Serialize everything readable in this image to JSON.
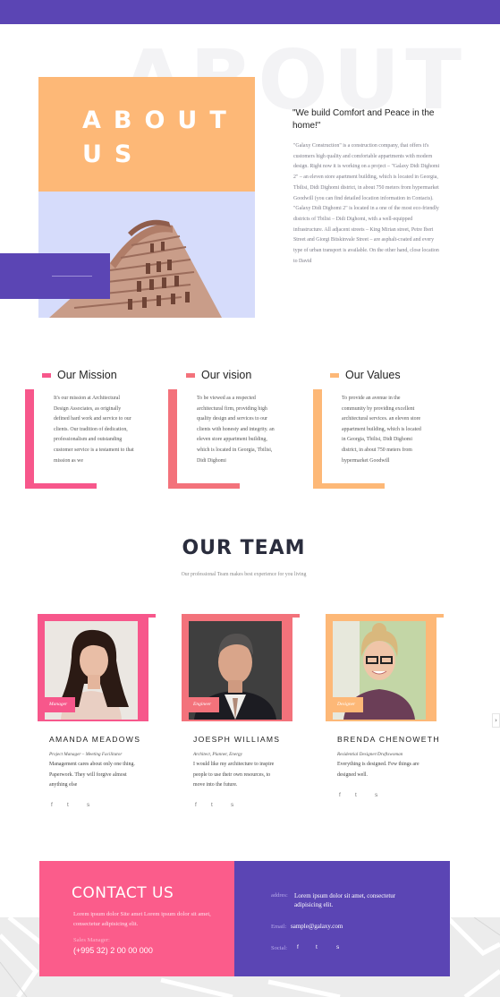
{
  "about": {
    "bg_word": "ABOUT",
    "title": "ABOUT US",
    "quote": "\"We build Comfort and Peace in the home!\"",
    "text": "\"Galaxy Construction\" is a construction company, that offers it's customers high quality and comfortable appartments with modern design. Right now it is working on a project – \"Galaxy Didi Dighomi 2\" – an eleven store apartment building, which is located in Georgia, Tbilisi, Didi Dighomi district, in about 750 meters from hypermarket Goodwill (you can find detailed location information in Contacts). \"Galaxy Didi Dighomi 2\" is located in a one of the most eco-friendly districts of Tbilisi – Didi Dighomi, with a well-equipped infrastructure. All adjacent streets – King Mirian street, Petre Iberi Street and Giorgi Bitskinvale Street – are asphalt-coated and every type of urban transport is available. On the other hand, close location to David"
  },
  "values": [
    {
      "title": "Our Mission",
      "color": "#f7578b",
      "text": "It's our mission at Architectural Design Associates, as originally defined hard work and service to our clients. Our tradition of dedication, professionalism and outstanding customer service is a testament to that mission as we"
    },
    {
      "title": "Our vision",
      "color": "#f3727b",
      "text": "To be viewed as a respected architectural firm, providing high quality design and services to our clients with honesty and integrity. an eleven store appartment building, which is located in Georgia, Tbilisi, Didi Dighomi"
    },
    {
      "title": "Our Values",
      "color": "#fdb877",
      "text": "To provide an avenue in the community by providing excellent architectural services. an eleven store appartment building, which is located in Georgia, Tbilisi, Didi Dighomi district, in about 750 meters from hypermarket Goodwill"
    }
  ],
  "team": {
    "title": "OUR TEAM",
    "subtitle": "Our professional Team makes best experience for you living",
    "members": [
      {
        "name": "AMANDA MEADOWS",
        "tag": "Manager",
        "role": "Project Manager – Meeting Facilitator",
        "desc": "Management cares about only one thing. Paperwork. They will forgive almost anything else",
        "color": "#f7578b"
      },
      {
        "name": "JOESPH WILLIAMS",
        "tag": "Engineer",
        "role": "Architect, Planner, Energy",
        "desc": "I would like my architecture to inspire people to use their own resources, to move into the future.",
        "color": "#f3727b"
      },
      {
        "name": "BRENDA CHENOWETH",
        "tag": "Designer",
        "role": "Residential Designer/Draftswoman",
        "desc": "Everything is designed. Few things are designed well.",
        "color": "#fdb877"
      }
    ],
    "social": [
      "f",
      "t",
      "s"
    ]
  },
  "nav": {
    "next": "›"
  },
  "contact": {
    "title": "CONTACT US",
    "text": "Lorem ipsum dolor Site amet Lorem ipsum dolor sit amet, consectetur adipisicing elit.",
    "sales_label": "Sales Manager:",
    "sales_phone": "(+995 32) 2 00 00 000",
    "address_label": "addres:",
    "address_value": "Lorem ipsum dolor sit amet, consectetur adipisicing elit.",
    "email_label": "Email:",
    "email_value": "sample@galaxy.com",
    "social_label": "Social:"
  },
  "colors": {
    "purple": "#5b45b4",
    "pink": "#fb5c8b",
    "orange": "#fdb877",
    "coral": "#f3727b"
  },
  "icons": [
    "facebook-icon",
    "twitter-icon",
    "skype-icon",
    "chevron-right-icon"
  ]
}
